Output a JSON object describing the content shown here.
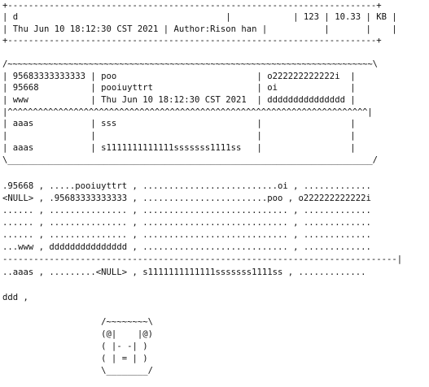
{
  "lines": [
    "+-----------------------------------------------------------------------+",
    "| d                                        |            | 123 | 10.33 | KB |",
    "| Thu Jun 10 18:12:30 CST 2021 | Author:Rison han |           |       |    |",
    "+-----------------------------------------------------------------------+",
    "",
    "/~~~~~~~~~~~~~~~~~~~~~~~~~~~~~~~~~~~~~~~~~~~~~~~~~~~~~~~~~~~~~~~~~~~~~~~~\\",
    "| 95683333333333 | poo                           | o222222222222i  |",
    "| 95668          | pooiuyttrt                    | oi              |",
    "| www            | Thu Jun 10 18:12:30 CST 2021  | ddddddddddddddd |",
    "|^^^^^^^^^^^^^^^^^^^^^^^^^^^^^^^^^^^^^^^^^^^^^^^^^^^^^^^^^^^^^^^^^^^^^^^|",
    "| aaas           | sss                           |                 |",
    "|                |                               |                 |",
    "| aaas           | s1111111111111sssssss1111ss   |                 |",
    "\\________________________________________________________________________/",
    "",
    ".95668 , .....pooiuyttrt , ..........................oi , .............",
    "<NULL> , .95683333333333 , ........................poo , o222222222222i",
    "...... , ............... , ............................ , .............",
    "...... , ............... , ............................ , .............",
    "...... , ............... , ............................ , .............",
    "...www , ddddddddddddddd , ............................ , .............",
    "----------------------------------------------------------------------------|",
    "..aaas , .........<NULL> , s1111111111111sssssss1111ss , .............",
    "",
    "ddd ,",
    "",
    "                   /~~~~~~~~\\",
    "                   (@|    |@)",
    "                   ( |- -| )",
    "                   ( | = | )",
    "                   \\________/"
  ]
}
